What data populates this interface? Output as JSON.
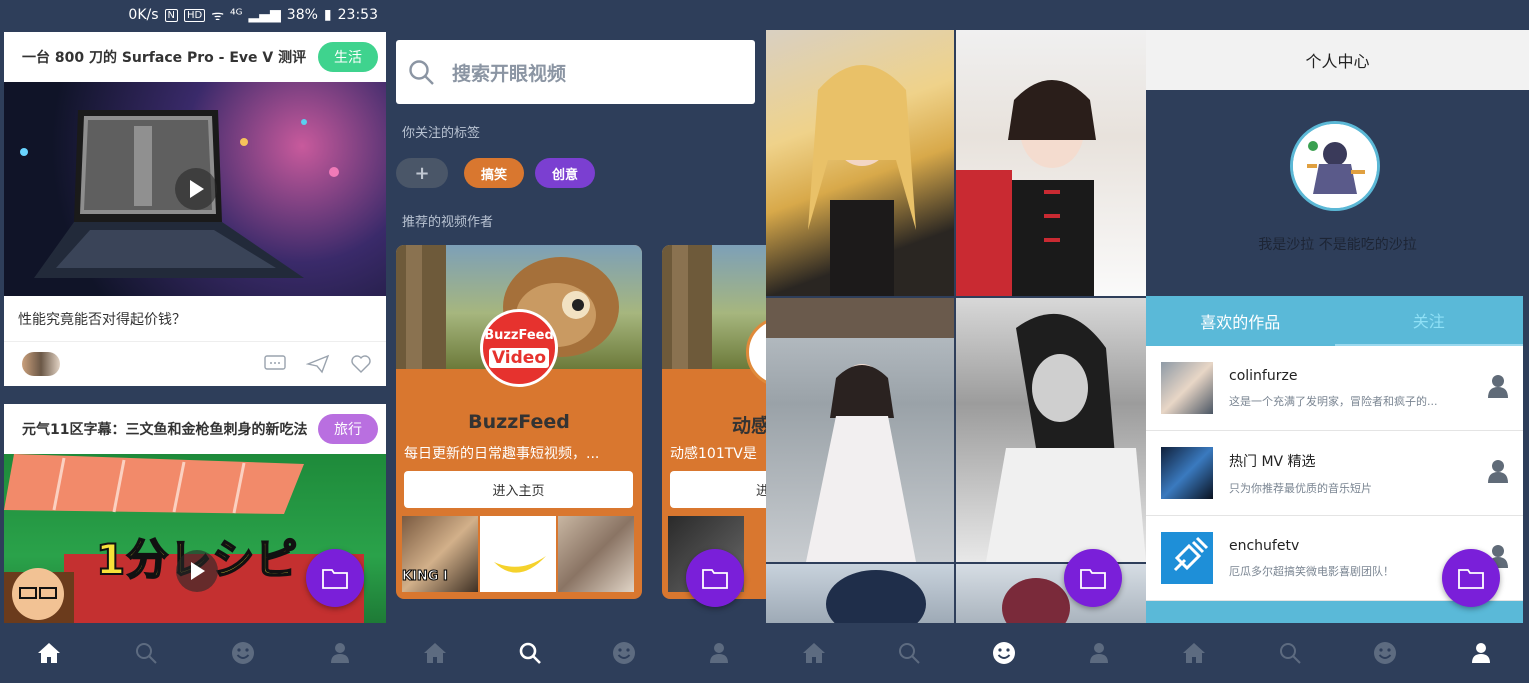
{
  "status_bar": {
    "speed": "0K/s",
    "hd": "HD",
    "network": "⁴ᴳ",
    "battery": "38%",
    "time": "23:53"
  },
  "feed": {
    "cards": [
      {
        "title": "一台 800 刀的 Surface Pro - Eve V 测评",
        "tag": "生活",
        "tag_color": "#3fd38e",
        "description": "性能究竟能否对得起价钱？"
      },
      {
        "title": "元气11区字幕：三文鱼和金枪鱼刺身的新吃法",
        "tag": "旅行",
        "tag_color": "#b96fe0",
        "overlay_text": "1分レシピ"
      }
    ]
  },
  "discover": {
    "search_placeholder": "搜索开眼视频",
    "followed_tags_label": "你关注的标签",
    "tags": [
      {
        "label": "+",
        "color": "#4a5668"
      },
      {
        "label": "搞笑",
        "color": "#d9772f"
      },
      {
        "label": "创意",
        "color": "#7b3fd1"
      }
    ],
    "recommended_label": "推荐的视频作者",
    "authors": [
      {
        "name": "BuzzFeed",
        "logo_top": "BuzzFeed",
        "logo_bottom": "Video",
        "description": "每日更新的日常趣事短视频，...",
        "button": "进入主页",
        "strip_text": "KING I"
      },
      {
        "name": "动感",
        "description": "动感101TV是",
        "button": "进"
      }
    ]
  },
  "profile": {
    "header_title": "个人中心",
    "bio": "我是沙拉 不是能吃的沙拉",
    "tabs": [
      "喜欢的作品",
      "关注"
    ],
    "following": [
      {
        "name": "colinfurze",
        "description": "这是一个充满了发明家，冒险者和疯子的..."
      },
      {
        "name": "热门 MV 精选",
        "description": "只为你推荐最优质的音乐短片"
      },
      {
        "name": "enchufetv",
        "description": "厄瓜多尔超搞笑微电影喜剧团队！"
      }
    ]
  },
  "nav": {
    "items": [
      "home-icon",
      "search-icon",
      "smiley-icon",
      "user-icon"
    ],
    "active_color": "#ffffff",
    "inactive_color": "#5d6b80"
  },
  "colors": {
    "fab": "#7a1fd9",
    "navy": "#2e3e5a",
    "accent_blue": "#5ab9d8"
  }
}
